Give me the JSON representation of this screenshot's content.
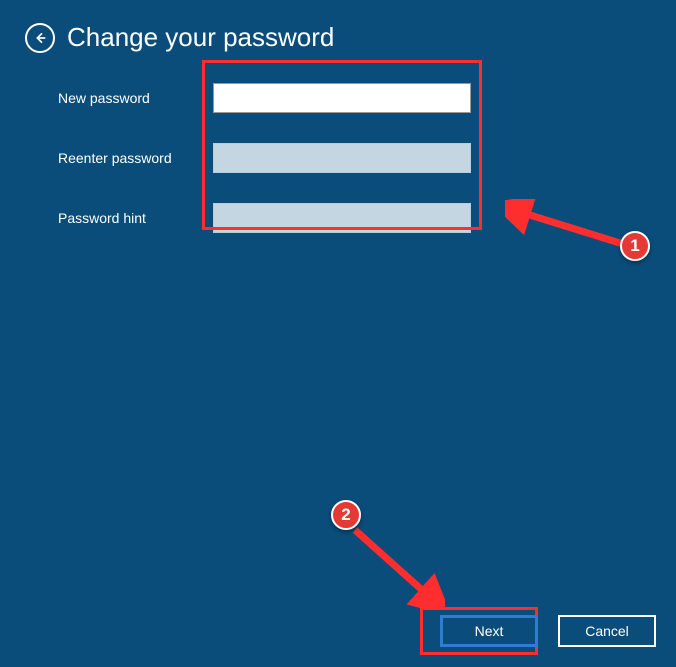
{
  "header": {
    "title": "Change your password"
  },
  "form": {
    "new_password_label": "New password",
    "new_password_value": "",
    "reenter_password_label": "Reenter password",
    "reenter_password_value": "",
    "password_hint_label": "Password hint",
    "password_hint_value": ""
  },
  "buttons": {
    "next_label": "Next",
    "cancel_label": "Cancel"
  },
  "annotations": {
    "badge_1": "1",
    "badge_2": "2"
  },
  "colors": {
    "background": "#0a4d7a",
    "highlight_border": "#ff2e2e",
    "badge_bg": "#e53935",
    "primary_button_border": "#2e7cd6"
  }
}
